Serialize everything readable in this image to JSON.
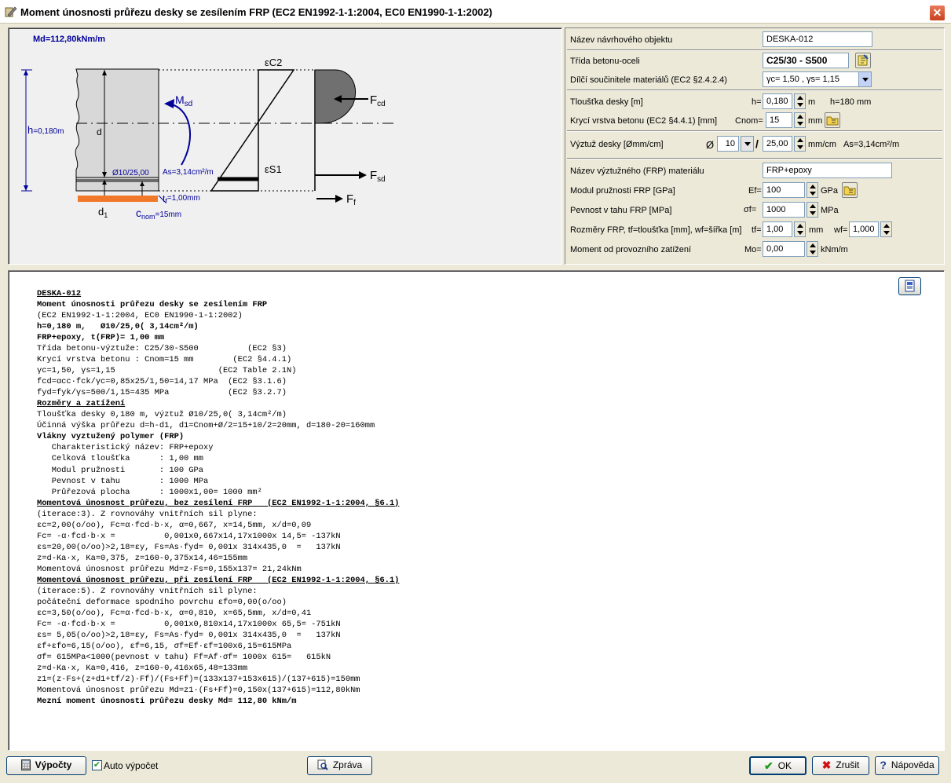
{
  "window": {
    "title": "Moment únosnosti průřezu desky se zesílením FRP (EC2 EN1992-1-1:2004, EC0 EN1990-1-1:2002)",
    "close_glyph": "✕"
  },
  "diagram": {
    "md_label": "Md=112,80kNm/m",
    "h_label": "h",
    "h_value": "=0,180m",
    "d_label": "d",
    "msd_label": "M",
    "msd_sub": "sd",
    "ec2_label": "εC2",
    "fcd_label": "F",
    "fcd_sub": "cd",
    "es1_label": "εS1",
    "fsd_label": "F",
    "fsd_sub": "sd",
    "ff_label": "F",
    "ff_sub": "f",
    "rebar_label": "Ø10/25,00",
    "as_label": "As=3,14cm²/m",
    "tf_label": "t",
    "tf_sub": "f",
    "tf_value": "=1,00mm",
    "d1_label": "d",
    "d1_sub": "1",
    "cnom_label": "c",
    "cnom_sub": "nom",
    "cnom_value": "=15mm",
    "colors": {
      "blue": "#000099",
      "orange": "#f07828",
      "concrete": "#d8d8d8",
      "compression": "#707070"
    }
  },
  "params": {
    "object_name_label": "Název návrhového objektu",
    "object_name_value": "DESKA-012",
    "concrete_class_label": "Třída betonu-oceli",
    "concrete_class_value": "C25/30 - S500",
    "safety_factors_label": "Dílčí součinitele materiálů (EC2 §2.4.2.4)",
    "safety_factors_value": "γc= 1,50 , γs= 1,15",
    "thickness_label": "Tloušťka desky [m]",
    "thickness_prefix": "h=",
    "thickness_value": "0,180",
    "thickness_unit": "m",
    "thickness_mm": "h=180 mm",
    "cover_label": "Krycí vrstva betonu (EC2 §4.4.1) [mm]",
    "cover_prefix": "Cnom=",
    "cover_value": "15",
    "cover_unit": "mm",
    "rebar_label": "Výztuž desky [Ømm/cm]",
    "rebar_prefix": "Ø",
    "rebar_dia": "10",
    "rebar_slash": "/",
    "rebar_spacing": "25,00",
    "rebar_unit": "mm/cm",
    "rebar_as": "As=3,14cm²/m",
    "frp_name_label": "Název výztužného (FRP) materiálu",
    "frp_name_value": "FRP+epoxy",
    "frp_modulus_label": "Modul pružnosti FRP [GPa]",
    "frp_modulus_prefix": "Ef=",
    "frp_modulus_value": "100",
    "frp_modulus_unit": "GPa",
    "frp_strength_label": "Pevnost v tahu FRP [MPa]",
    "frp_strength_prefix": "σf=",
    "frp_strength_value": "1000",
    "frp_strength_unit": "MPa",
    "frp_dims_label": "Rozměry FRP, tf=tloušťka [mm], wf=šířka [m]",
    "frp_tf_prefix": "tf=",
    "frp_tf_value": "1,00",
    "frp_tf_unit": "mm",
    "frp_wf_prefix": "wf=",
    "frp_wf_value": "1,000",
    "service_moment_label": "Moment od provozního zatížení",
    "service_moment_prefix": "Mo=",
    "service_moment_value": "0,00",
    "service_moment_unit": "kNm/m"
  },
  "report": {
    "lines": [
      {
        "t": "DESKA-012",
        "s": "u"
      },
      {
        "t": "Moment únosnosti průřezu desky se zesílením FRP",
        "s": "b"
      },
      {
        "t": "(EC2 EN1992-1-1:2004, EC0 EN1990-1-1:2002)",
        "s": ""
      },
      {
        "t": "h=0,180 m,   Ø10/25,0( 3,14cm²/m)",
        "s": "b"
      },
      {
        "t": "FRP+epoxy, t(FRP)= 1,00 mm",
        "s": "b"
      },
      {
        "t": "Třída betonu-výztuže: C25/30-S500          (EC2 §3)",
        "s": ""
      },
      {
        "t": "Krycí vrstva betonu : Cnom=15 mm        (EC2 §4.4.1)",
        "s": ""
      },
      {
        "t": "γc=1,50, γs=1,15                     (EC2 Table 2.1N)",
        "s": ""
      },
      {
        "t": "fcd=αcc·fck/γc=0,85x25/1,50=14,17 MPa  (EC2 §3.1.6)",
        "s": ""
      },
      {
        "t": "fyd=fyk/γs=500/1,15=435 MPa            (EC2 §3.2.7)",
        "s": ""
      },
      {
        "t": "Rozměry a zatížení",
        "s": "u"
      },
      {
        "t": "Tloušťka desky 0,180 m, výztuž Ø10/25,0( 3,14cm²/m)",
        "s": ""
      },
      {
        "t": "Účinná výška průřezu d=h-d1, d1=Cnom+Ø/2=15+10/2=20mm, d=180-20=160mm",
        "s": ""
      },
      {
        "t": "Vlákny vyztužený polymer (FRP)",
        "s": "b"
      },
      {
        "t": "   Charakteristický název: FRP+epoxy",
        "s": ""
      },
      {
        "t": "   Celková tloušťka      : 1,00 mm",
        "s": ""
      },
      {
        "t": "   Modul pružnosti       : 100 GPa",
        "s": ""
      },
      {
        "t": "   Pevnost v tahu        : 1000 MPa",
        "s": ""
      },
      {
        "t": "   Průřezová plocha      : 1000x1,00= 1000 mm²",
        "s": ""
      },
      {
        "t": "Momentová únosnost průřezu, bez zesílení FRP   (EC2 EN1992-1-1:2004, §6.1)",
        "s": "u"
      },
      {
        "t": "(iterace:3). Z rovnováhy vnitřních sil plyne:",
        "s": ""
      },
      {
        "t": "εc=2,00(o/oo), Fc=α·fcd·b·x, α=0,667, x=14,5mm, x/d=0,09",
        "s": ""
      },
      {
        "t": "Fc= -α·fcd·b·x =          0,001x0,667x14,17x1000x 14,5= -137kN",
        "s": ""
      },
      {
        "t": "εs=20,00(o/oo)>2,18=εy, Fs=As·fyd= 0,001x 314x435,0  =   137kN",
        "s": ""
      },
      {
        "t": "z=d-Ka·x, Ka=0,375, z=160-0,375x14,46=155mm",
        "s": ""
      },
      {
        "t": "Momentová únosnost průřezu Md=z·Fs=0,155x137= 21,24kNm",
        "s": ""
      },
      {
        "t": "Momentová únosnost průřezu, při zesílení FRP   (EC2 EN1992-1-1:2004, §6.1)",
        "s": "u"
      },
      {
        "t": "(iterace:5). Z rovnováhy vnitřních sil plyne:",
        "s": ""
      },
      {
        "t": "počáteční deformace spodního povrchu εfo=0,00(o/oo)",
        "s": ""
      },
      {
        "t": "εc=3,50(o/oo), Fc=α·fcd·b·x, α=0,810, x=65,5mm, x/d=0,41",
        "s": ""
      },
      {
        "t": "Fc= -α·fcd·b·x =          0,001x0,810x14,17x1000x 65,5= -751kN",
        "s": ""
      },
      {
        "t": "εs= 5,05(o/oo)>2,18=εy, Fs=As·fyd= 0,001x 314x435,0  =   137kN",
        "s": ""
      },
      {
        "t": "εf+εfo=6,15(o/oo), εf=6,15, σf=Ef·εf=100x6,15=615MPa",
        "s": ""
      },
      {
        "t": "σf= 615MPa<1000(pevnost v tahu) Ff=Af·σf= 1000x 615=   615kN",
        "s": ""
      },
      {
        "t": "z=d-Ka·x, Ka=0,416, z=160-0,416x65,48=133mm",
        "s": ""
      },
      {
        "t": "z1=(z·Fs+(z+d1+tf/2)·Ff)/(Fs+Ff)=(133x137+153x615)/(137+615)=150mm",
        "s": ""
      },
      {
        "t": "Momentová únosnost průřezu Md=z1·(Fs+Ff)=0,150x(137+615)=112,80kNm",
        "s": ""
      },
      {
        "t": "Mezní moment únosnosti průřezu desky Md= 112,80 kNm/m",
        "s": "b"
      }
    ]
  },
  "footer": {
    "calc_label": "Výpočty",
    "auto_calc_label": "Auto výpočet",
    "auto_calc_checked": true,
    "report_label": "Zpráva",
    "ok_label": "OK",
    "cancel_label": "Zrušit",
    "help_label": "Nápověda"
  }
}
